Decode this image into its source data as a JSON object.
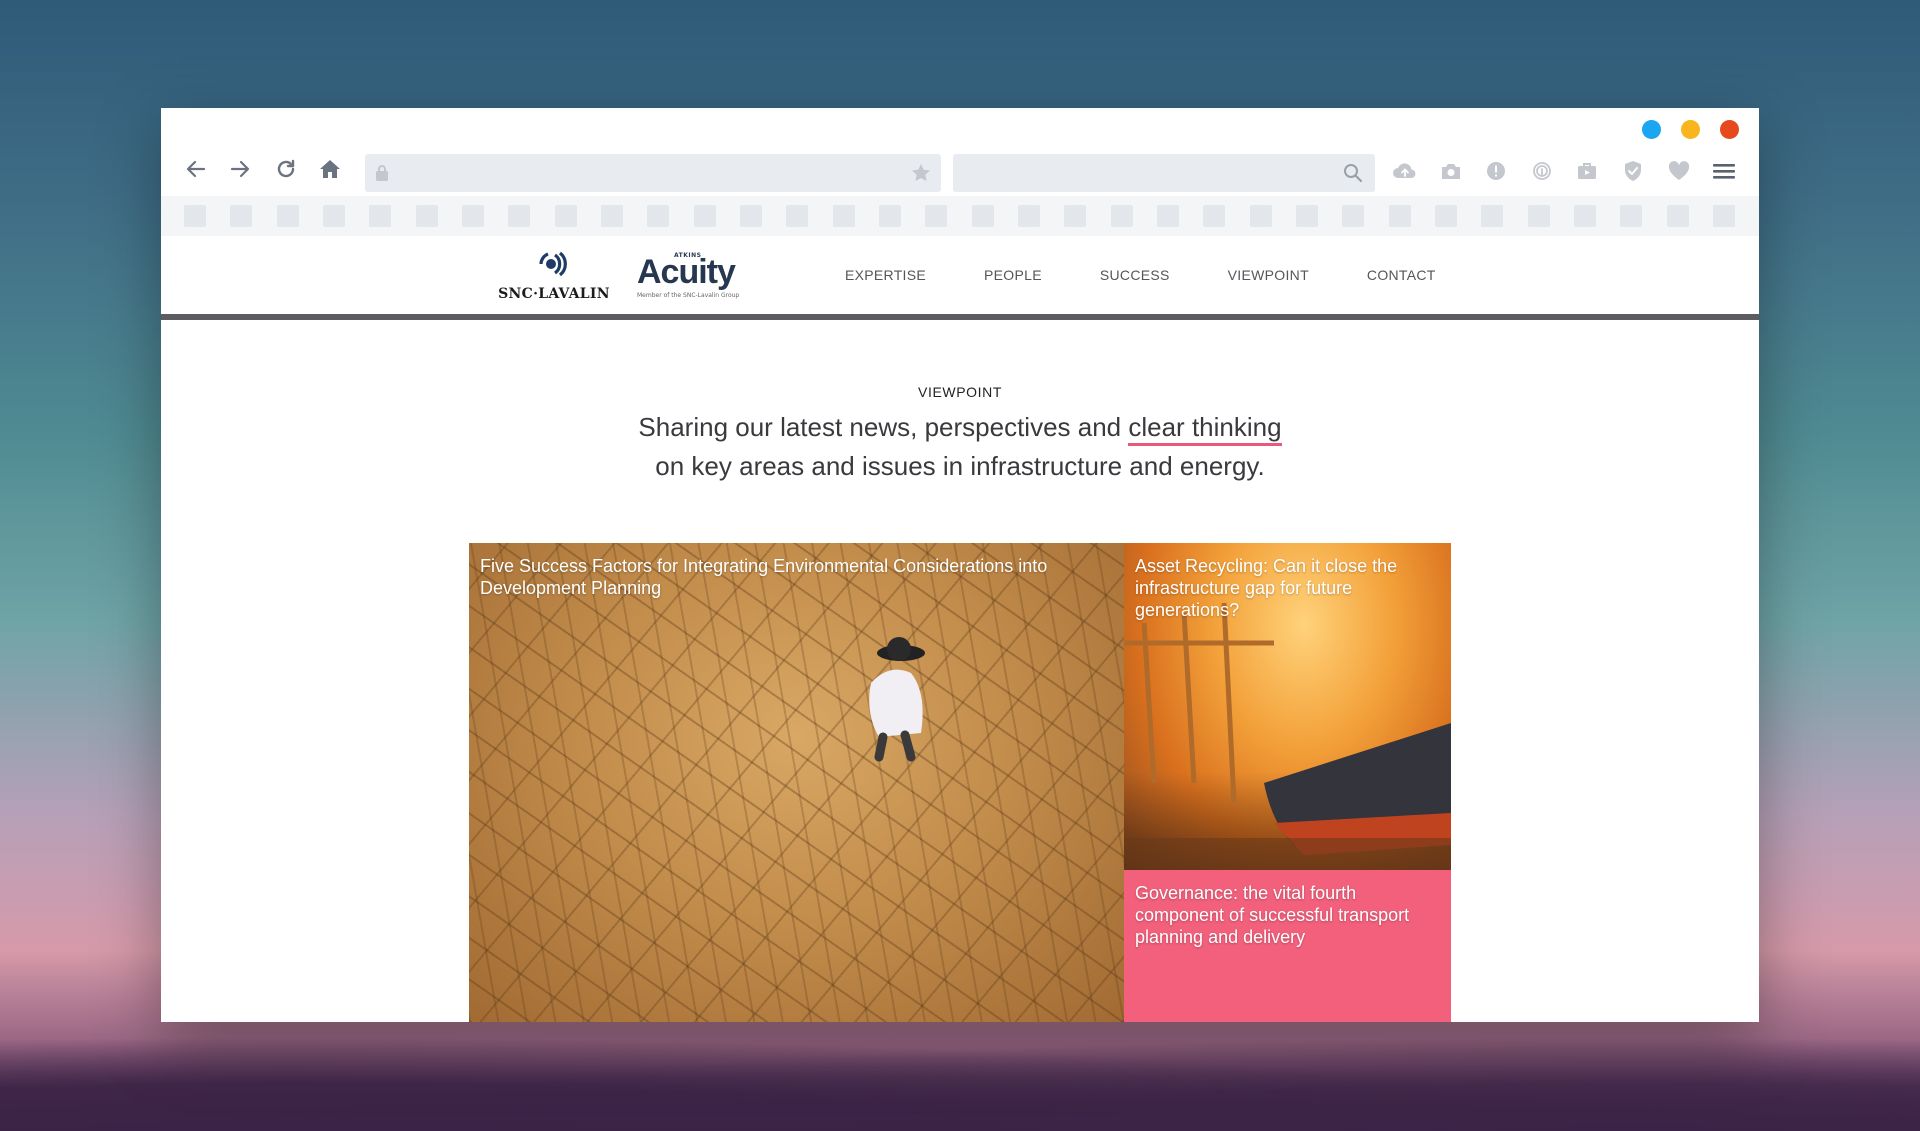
{
  "window": {
    "traffic_colors": [
      "#1aa6f0",
      "#f8b51d",
      "#e8481e"
    ]
  },
  "toolbar": {
    "icons": [
      "back-arrow-icon",
      "forward-arrow-icon",
      "reload-icon",
      "home-icon",
      "lock-icon",
      "star-icon",
      "search-icon",
      "cloud-upload-icon",
      "camera-icon",
      "alert-icon",
      "fingerprint-icon",
      "briefcase-icon",
      "shield-check-icon",
      "heart-icon",
      "hamburger-menu-icon"
    ]
  },
  "site": {
    "snc_logo_text": "SNC·LAVALIN",
    "acuity_small": "ATKINS",
    "acuity_word": "Acuity",
    "acuity_sub": "Member of the SNC-Lavalin Group",
    "nav": [
      "EXPERTISE",
      "PEOPLE",
      "SUCCESS",
      "VIEWPOINT",
      "CONTACT"
    ],
    "accent_color": "#f2607c",
    "header_rule_color": "#5c5d62"
  },
  "intro": {
    "kicker": "VIEWPOINT",
    "lead_part1": "Sharing our latest news, perspectives and ",
    "lead_highlight": "clear thinking",
    "lead_part2": "on key areas and issues in infrastructure and energy."
  },
  "cards": [
    {
      "title": "Five Success Factors for Integrating Environmental Considerations into Development Planning"
    },
    {
      "title": "Asset Recycling: Can it close the infrastructure gap for future generations?"
    },
    {
      "title": "Governance: the vital fourth component of successful transport planning and delivery"
    }
  ]
}
